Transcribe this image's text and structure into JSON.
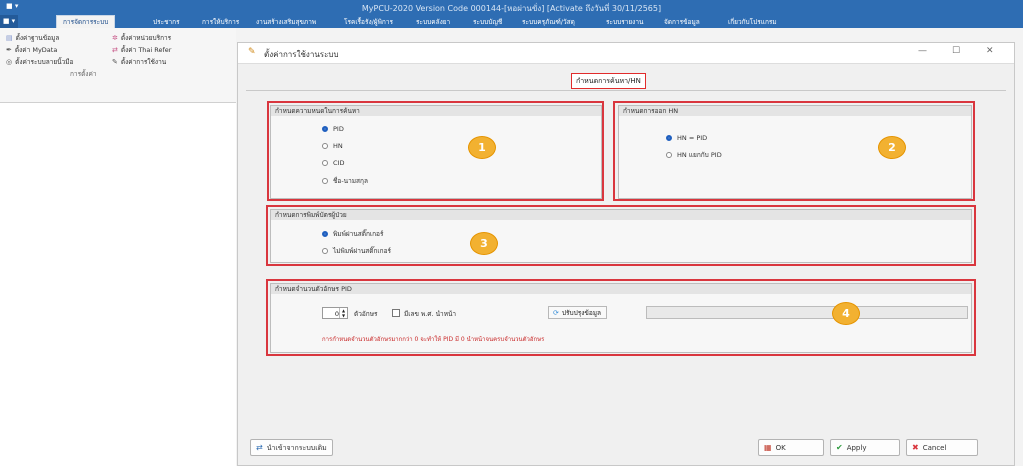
{
  "window": {
    "title": "MyPCU-2020 Version Code 000144-[หอผ่านขั่ง] [Activate ถึงวันที่ 30/11/2565]",
    "quick_access": "■ ▾"
  },
  "menu": {
    "file_label": "■ ▾",
    "items": [
      "การจัดการระบบ",
      "ประชากร",
      "การให้บริการ",
      "งานสร้างเสริมสุขภาพ",
      "โรคเรื้อรัง/ผู้พิการ",
      "ระบบคลังยา",
      "ระบบบัญชี",
      "ระบบครุภัณฑ์/วัสดุ",
      "ระบบรายงาน",
      "จัดการข้อมูล",
      "เกี่ยวกับโปรแกรม"
    ],
    "active_index": 0
  },
  "ribbon": {
    "items": [
      {
        "label": "ตั้งค่าฐานข้อมูล",
        "icon": "database-icon"
      },
      {
        "label": "ตั้งค่าหน่วยบริการ",
        "icon": "gear-icon"
      },
      {
        "label": "ตั้งค่า MyData",
        "icon": "feather-icon"
      },
      {
        "label": "ตั้งค่า Thai Refer",
        "icon": "transfer-icon"
      },
      {
        "label": "ตั้งค่าระบบลายนิ้วมือ",
        "icon": "fingerprint-icon"
      },
      {
        "label": "ตั้งค่าการใช้งาน",
        "icon": "wrench-icon"
      }
    ],
    "group_label": "การตั้งค่า"
  },
  "dialog": {
    "title": "ตั้งค่าการใช้งานระบบ",
    "tab_label": "กำหนดการค้นหา/HN",
    "search_group": {
      "caption": "กำหนดความหนดในการค้นหา",
      "options": [
        "PID",
        "HN",
        "CID",
        "ชื่อ-นามสกุล"
      ],
      "selected": "PID"
    },
    "hn_group": {
      "caption": "กำหนดการออก HN",
      "options": [
        "HN = PID",
        "HN แยกกับ PID"
      ],
      "selected": "HN = PID"
    },
    "sticker_group": {
      "caption": "กำหนดการพิมพ์บัตรผู้ป่วย",
      "options": [
        "พิมพ์ผ่านสติ๊กเกอร์",
        "ไม่พิมพ์ผ่านสติ๊กเกอร์"
      ],
      "selected": "พิมพ์ผ่านสติ๊กเกอร์"
    },
    "pid_group": {
      "caption": "กำหนดจำนวนตัวอักษร PID",
      "digits_value": "0",
      "digits_label": "ตัวอักษร",
      "prefix_checkbox_label": "มีเลข พ.ศ. นำหน้า",
      "update_button": "ปรับปรุงข้อมูล",
      "warning": "การกำหนดจำนวนตัวอักษรมากกว่า 0 จะทำให้ PID มี 0 นำหน้าจนครบจำนวนตัวอักษร"
    },
    "badges": [
      "1",
      "2",
      "3",
      "4"
    ],
    "buttons": {
      "import": "นำเข้าจากระบบเดิม",
      "ok": "OK",
      "apply": "Apply",
      "cancel": "Cancel"
    },
    "window_controls": {
      "minimize": "—",
      "maximize": "☐",
      "close": "✕"
    }
  },
  "colors": {
    "titlebar": "#2e6db3",
    "highlight_red": "#d9363e",
    "badge_orange": "#f2b131",
    "radio_blue": "#1f5fbf",
    "warning_red": "#c92a2a"
  }
}
